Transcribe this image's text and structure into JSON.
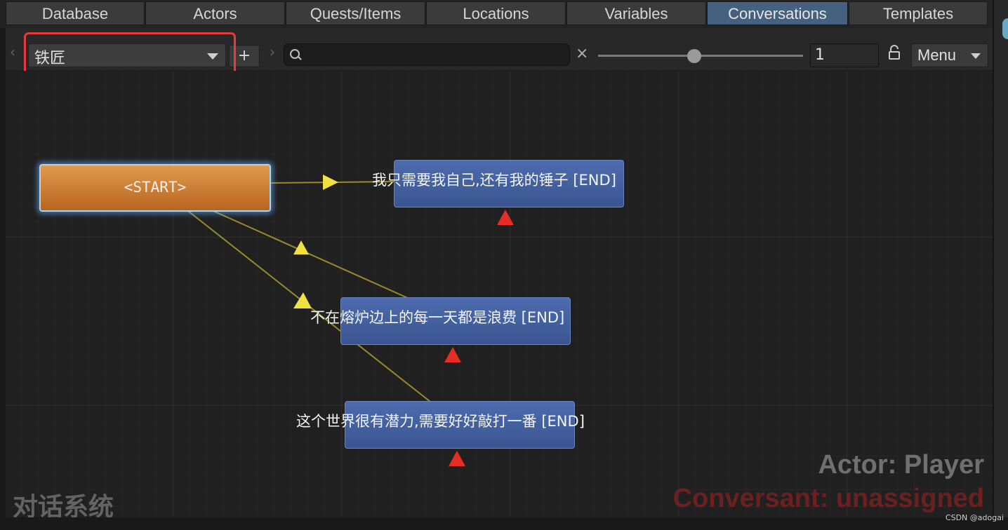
{
  "tabs": [
    {
      "label": "Database",
      "active": false
    },
    {
      "label": "Actors",
      "active": false
    },
    {
      "label": "Quests/Items",
      "active": false
    },
    {
      "label": "Locations",
      "active": false
    },
    {
      "label": "Variables",
      "active": false
    },
    {
      "label": "Conversations",
      "active": true
    },
    {
      "label": "Templates",
      "active": false
    }
  ],
  "toolbar": {
    "conversation_selected": "铁匠",
    "add_label": "+",
    "search_value": "",
    "clear_label": "×",
    "zoom_slider_fraction": 0.47,
    "zoom_value": "1",
    "menu_label": "Menu"
  },
  "nodes": {
    "start": "<START>",
    "reply1": "我只需要我自己,还有我的锤子 [END]",
    "reply2": "不在熔炉边上的每一天都是浪费  [END]",
    "reply3": "这个世界很有潜力,需要好好敲打一番  [END]"
  },
  "overlay": {
    "actor": "Actor: Player",
    "conversant": "Conversant: unassigned",
    "system_title": "对话系统"
  },
  "watermark": "CSDN @adogai",
  "colors": {
    "active_tab": "#46607f",
    "start_node": "#c97a2f",
    "dialogue_node": "#4461a0",
    "link_line": "#9a8a2a",
    "link_arrow": "#f0e040",
    "highlight_box": "#e83a3a",
    "end_marker": "#e52d24"
  }
}
